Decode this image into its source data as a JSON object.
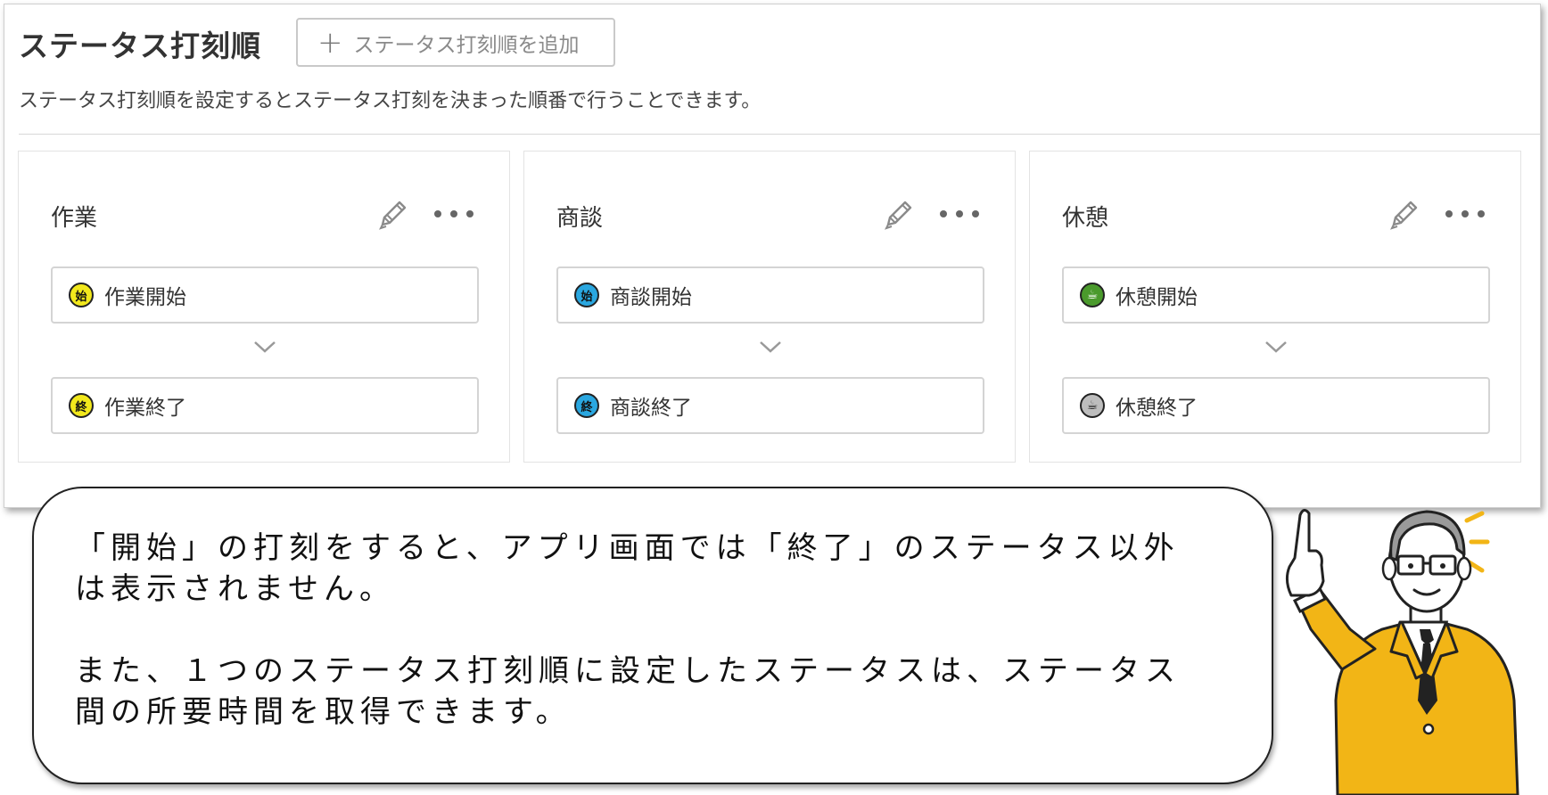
{
  "panel": {
    "title": "ステータス打刻順",
    "add_button_label": "ステータス打刻順を追加",
    "description": "ステータス打刻順を設定するとステータス打刻を決まった順番で行うことできます。"
  },
  "cards": [
    {
      "title": "作業",
      "start": {
        "label": "作業開始",
        "icon_text": "始",
        "icon_color": "#f2e81c"
      },
      "end": {
        "label": "作業終了",
        "icon_text": "終",
        "icon_color": "#f2e81c"
      }
    },
    {
      "title": "商談",
      "start": {
        "label": "商談開始",
        "icon_text": "始",
        "icon_color": "#2aa7e0"
      },
      "end": {
        "label": "商談終了",
        "icon_text": "終",
        "icon_color": "#2aa7e0"
      }
    },
    {
      "title": "休憩",
      "start": {
        "label": "休憩開始",
        "icon_text": "☕",
        "icon_color": "#4a9a2c"
      },
      "end": {
        "label": "休憩終了",
        "icon_text": "☕",
        "icon_color": "#bdbdbd"
      }
    }
  ],
  "icons": {
    "add": "plus-icon",
    "edit": "pencil-icon",
    "more": "more-horizontal-icon",
    "chevron": "chevron-down-icon"
  },
  "bubble": {
    "paragraph1_line1": "「開始」の打刻をすると、アプリ画面では「終了」のステータス以外",
    "paragraph1_line2": "は表示されません。",
    "paragraph2_line1": "また、１つのステータス打刻順に設定したステータスは、ステータス",
    "paragraph2_line2": "間の所要時間を取得できます。"
  },
  "colors": {
    "character_suit": "#f2b516",
    "panel_border": "#cfcfcf"
  }
}
